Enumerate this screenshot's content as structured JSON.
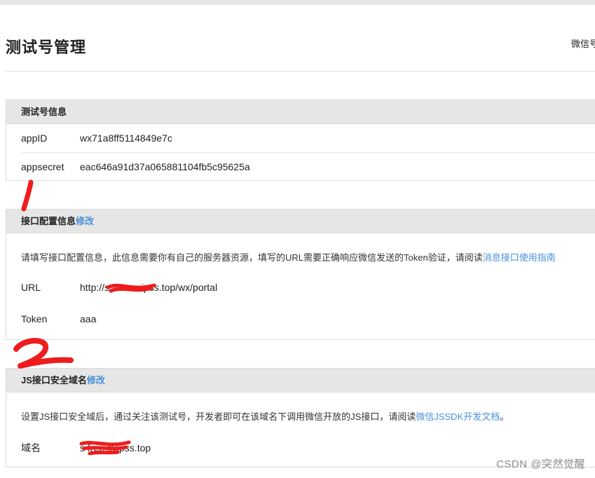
{
  "page": {
    "title": "测试号管理",
    "header_link": "微信号"
  },
  "info_panel": {
    "title": "测试号信息",
    "appid_label": "appID",
    "appid_value": "wx71a8ff5114849e7c",
    "appsecret_label": "appsecret",
    "appsecret_value": "eac646a91d37a065881104fb5c95625a"
  },
  "interface_panel": {
    "title": "接口配置信息",
    "edit_label": "修改",
    "description": "请填写接口配置信息，此信息需要你有自己的服务器资源，填写的URL需要正确响应微信发送的Token验证，请阅读",
    "doc_link": "消息接口使用指南",
    "url_label": "URL",
    "url_value": "http://s        free.svipss.top/wx/portal",
    "token_label": "Token",
    "token_value": "aaa"
  },
  "js_panel": {
    "title": "JS接口安全域名",
    "edit_label": "修改",
    "description": "设置JS接口安全域后，通过关注该测试号，开发者即可在该域名下调用微信开放的JS接口，请阅读",
    "doc_link": "微信JSSDK开发文档",
    "description_end": "。",
    "domain_label": "域名",
    "domain_value": "s        free.svipss.top"
  },
  "annotations": {
    "mark_1": "1",
    "mark_2": "2",
    "color": "#ee1c1c"
  },
  "watermark": "CSDN @突然觉醒"
}
